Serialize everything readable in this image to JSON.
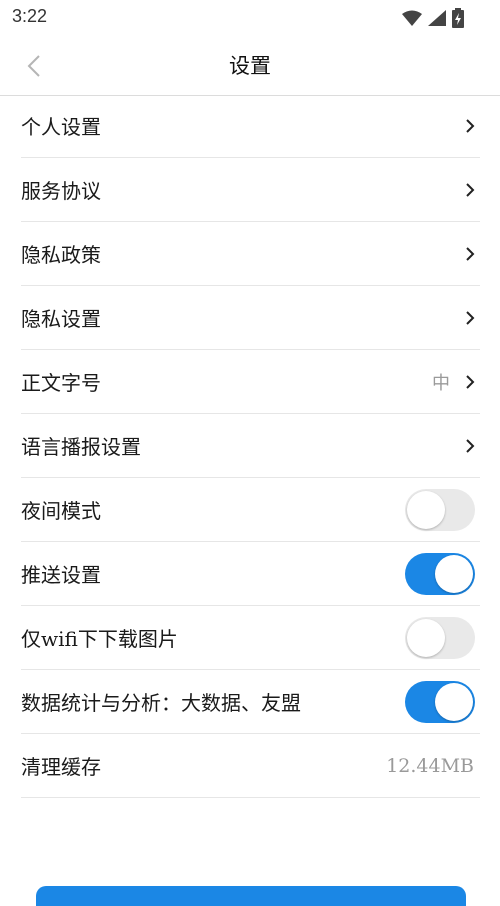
{
  "status_bar": {
    "time": "3:22"
  },
  "header": {
    "title": "设置"
  },
  "rows": [
    {
      "label": "个人设置"
    },
    {
      "label": "服务协议"
    },
    {
      "label": "隐私政策"
    },
    {
      "label": "隐私设置"
    },
    {
      "label": "正文字号",
      "value": "中"
    },
    {
      "label": "语言播报设置"
    },
    {
      "label": "夜间模式",
      "toggle": "off"
    },
    {
      "label": "推送设置",
      "toggle": "on"
    },
    {
      "label": "仅wifi下下载图片",
      "toggle": "off"
    },
    {
      "label": "数据统计与分析：大数据、友盟",
      "toggle": "on"
    },
    {
      "label": "清理缓存",
      "value": "12.44MB"
    }
  ],
  "colors": {
    "accent": "#1b87e5",
    "toggle_off": "#e9e9e9",
    "divider": "#e6e6e6"
  }
}
